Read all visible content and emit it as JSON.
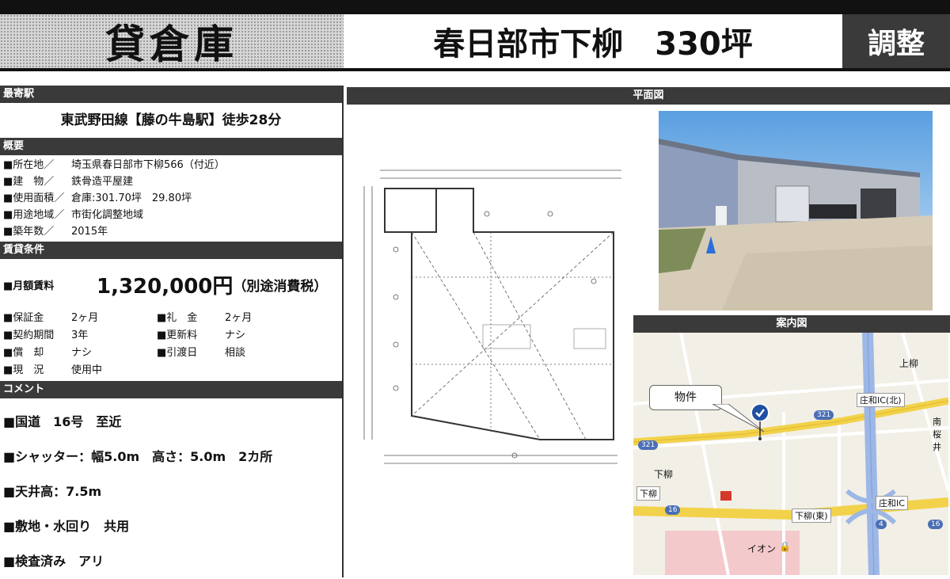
{
  "header": {
    "type_label": "貸倉庫",
    "title": "春日部市下柳　330坪",
    "status_badge": "調整"
  },
  "sections": {
    "station": "最寄駅",
    "overview": "概要",
    "terms": "賃貸条件",
    "comment": "コメント",
    "floor_plan": "平面図",
    "map": "案内図"
  },
  "station": "東武野田線【藤の牛島駅】徒歩28分",
  "overview": [
    {
      "label": "■所在地／",
      "value": "埼玉県春日部市下柳566（付近）"
    },
    {
      "label": "■建　物／",
      "value": "鉄骨造平屋建"
    },
    {
      "label": "■使用面積／",
      "value": "倉庫:301.70坪　29.80坪"
    },
    {
      "label": "■用途地域／",
      "value": "市街化調整地域"
    },
    {
      "label": "■築年数／",
      "value": "2015年"
    }
  ],
  "rent": {
    "label": "■月額賃料",
    "amount": "1,320,000円",
    "tax": "（別途消費税）"
  },
  "fees": [
    {
      "label": "■保証金",
      "value": "2ヶ月",
      "label2": "■礼　金",
      "value2": "2ヶ月"
    },
    {
      "label": "■契約期間",
      "value": "3年",
      "label2": "■更新料",
      "value2": "ナシ"
    },
    {
      "label": "■償　却",
      "value": "ナシ",
      "label2": "■引渡日",
      "value2": "相談"
    },
    {
      "label": "■現　況",
      "value": "使用中",
      "label2": "",
      "value2": ""
    }
  ],
  "comments": [
    "■国道　16号　至近",
    "■シャッター：幅5.0m　高さ：5.0m　2カ所",
    "■天井高：7.5m",
    "■敷地・水回り　共用",
    "■検査済み　アリ"
  ],
  "map": {
    "property_label": "物件",
    "places": {
      "kamiyanagi": "上柳",
      "showa_ic_north": "庄和IC(北)",
      "minami_sakurai": "南桜井",
      "shimoyanagi_1": "下柳",
      "shimoyanagi_2": "下柳",
      "showa_ic": "庄和IC",
      "shimoyanagi_east": "下柳(東)",
      "aeon": "イオン"
    },
    "routes": [
      "321",
      "321",
      "16",
      "4",
      "16"
    ]
  },
  "colors": {
    "bar": "#3a3a3a",
    "accent_pin": "#1f4fa0",
    "road_main": "#f2d24a"
  }
}
